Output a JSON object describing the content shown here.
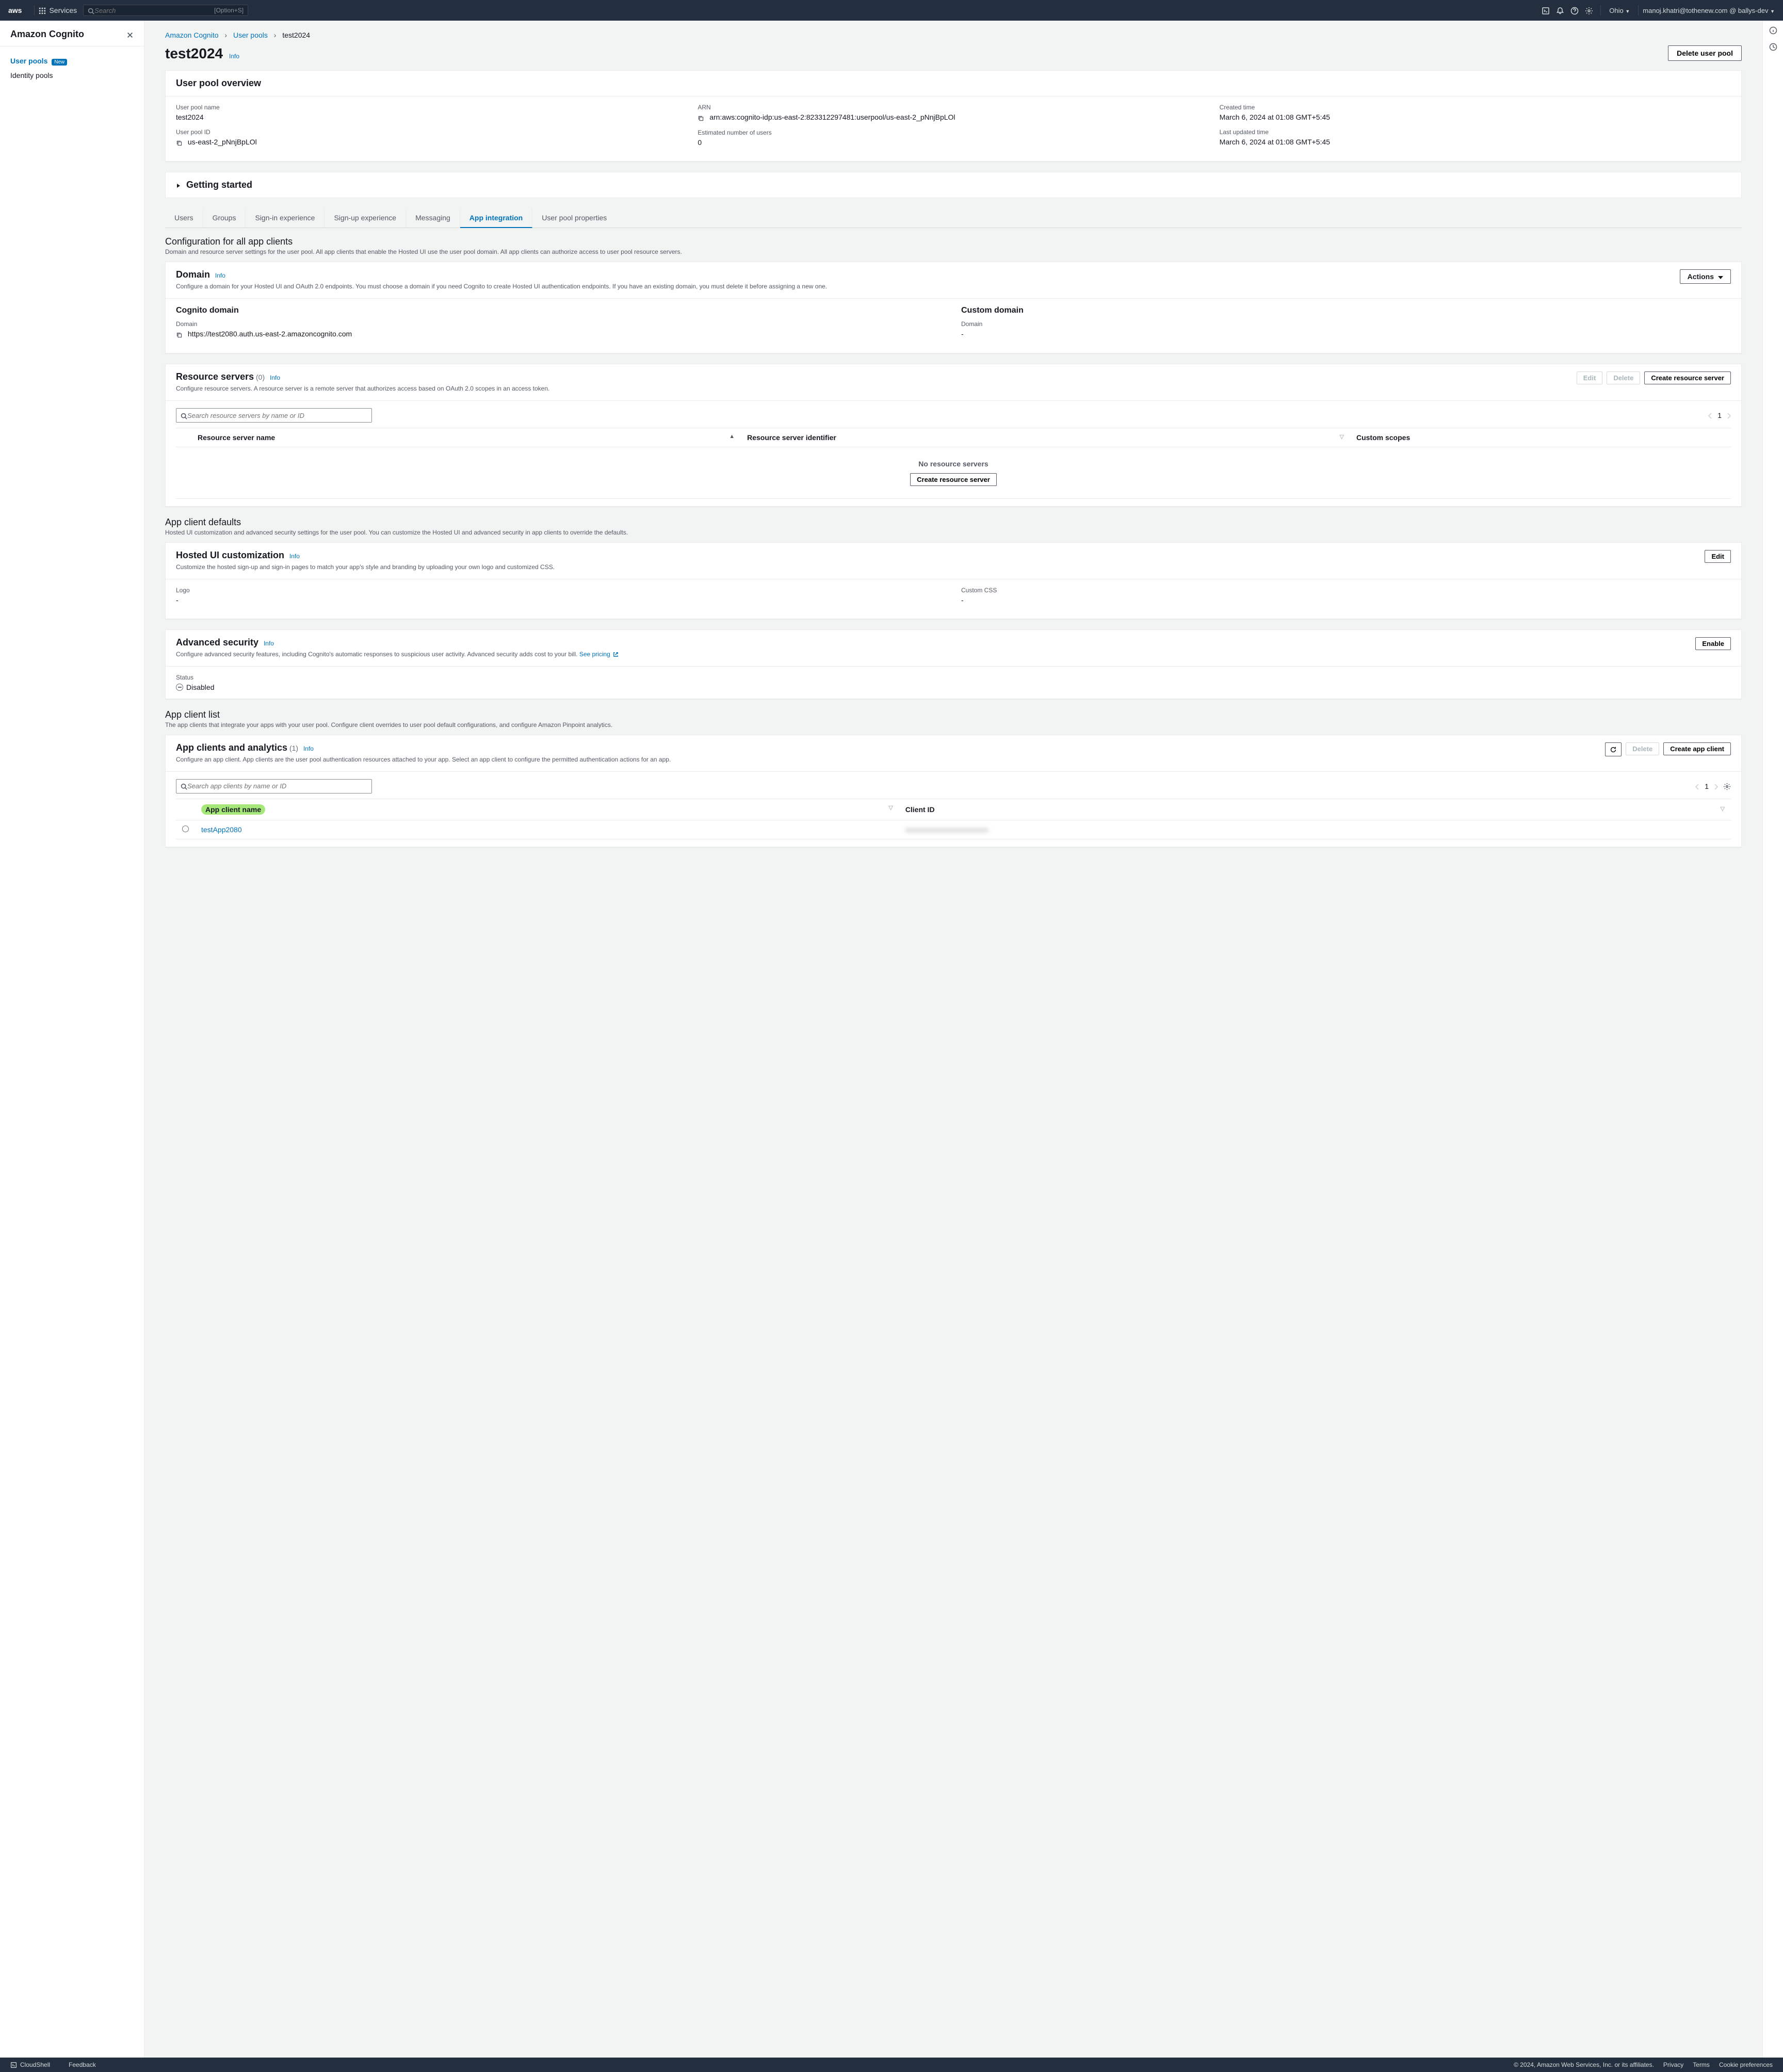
{
  "topnav": {
    "logo": "aws",
    "services": "Services",
    "search_placeholder": "Search",
    "shortcut": "[Option+S]",
    "region": "Ohio",
    "user": "manoj.khatri@tothenew.com @ ballys-dev"
  },
  "sidebar": {
    "title": "Amazon Cognito",
    "items": [
      {
        "label": "User pools",
        "badge": "New",
        "active": true
      },
      {
        "label": "Identity pools",
        "active": false
      }
    ]
  },
  "breadcrumb": {
    "items": [
      "Amazon Cognito",
      "User pools",
      "test2024"
    ]
  },
  "page": {
    "title": "test2024",
    "info": "Info",
    "delete_btn": "Delete user pool"
  },
  "overview": {
    "title": "User pool overview",
    "name_label": "User pool name",
    "name_value": "test2024",
    "id_label": "User pool ID",
    "id_value": "us-east-2_pNnjBpLOl",
    "arn_label": "ARN",
    "arn_value": "arn:aws:cognito-idp:us-east-2:823312297481:userpool/us-east-2_pNnjBpLOl",
    "users_label": "Estimated number of users",
    "users_value": "0",
    "created_label": "Created time",
    "created_value": "March 6, 2024 at 01:08 GMT+5:45",
    "updated_label": "Last updated time",
    "updated_value": "March 6, 2024 at 01:08 GMT+5:45"
  },
  "getting_started": "Getting started",
  "tabs": [
    "Users",
    "Groups",
    "Sign-in experience",
    "Sign-up experience",
    "Messaging",
    "App integration",
    "User pool properties"
  ],
  "active_tab": "App integration",
  "config_section": {
    "title": "Configuration for all app clients",
    "desc": "Domain and resource server settings for the user pool. All app clients that enable the Hosted UI use the user pool domain. All app clients can authorize access to user pool resource servers."
  },
  "domain_panel": {
    "title": "Domain",
    "info": "Info",
    "desc": "Configure a domain for your Hosted UI and OAuth 2.0 endpoints. You must choose a domain if you need Cognito to create Hosted UI authentication endpoints. If you have an existing domain, you must delete it before assigning a new one.",
    "actions_btn": "Actions",
    "cognito_domain_h": "Cognito domain",
    "domain_label": "Domain",
    "domain_value": "https://test2080.auth.us-east-2.amazoncognito.com",
    "custom_domain_h": "Custom domain",
    "custom_domain_label": "Domain",
    "custom_domain_value": "-"
  },
  "resource_servers": {
    "title": "Resource servers",
    "count": "(0)",
    "info": "Info",
    "desc": "Configure resource servers. A resource server is a remote server that authorizes access based on OAuth 2.0 scopes in an access token.",
    "edit_btn": "Edit",
    "delete_btn": "Delete",
    "create_btn": "Create resource server",
    "search_placeholder": "Search resource servers by name or ID",
    "page_num": "1",
    "col1": "Resource server name",
    "col2": "Resource server identifier",
    "col3": "Custom scopes",
    "empty_msg": "No resource servers",
    "empty_btn": "Create resource server"
  },
  "app_defaults": {
    "title": "App client defaults",
    "desc": "Hosted UI customization and advanced security settings for the user pool. You can customize the Hosted UI and advanced security in app clients to override the defaults."
  },
  "hosted_ui": {
    "title": "Hosted UI customization",
    "info": "Info",
    "desc": "Customize the hosted sign-up and sign-in pages to match your app's style and branding by uploading your own logo and customized CSS.",
    "edit_btn": "Edit",
    "logo_label": "Logo",
    "logo_value": "-",
    "css_label": "Custom CSS",
    "css_value": "-"
  },
  "advanced_security": {
    "title": "Advanced security",
    "info": "Info",
    "desc_prefix": "Configure advanced security features, including Cognito's automatic responses to suspicious user activity. Advanced security adds cost to your bill. ",
    "pricing_link": "See pricing",
    "enable_btn": "Enable",
    "status_label": "Status",
    "status_value": "Disabled"
  },
  "app_client_list": {
    "title": "App client list",
    "desc": "The app clients that integrate your apps with your user pool. Configure client overrides to user pool default configurations, and configure Amazon Pinpoint analytics."
  },
  "app_clients": {
    "title": "App clients and analytics",
    "count": "(1)",
    "info": "Info",
    "desc": "Configure an app client. App clients are the user pool authentication resources attached to your app. Select an app client to configure the permitted authentication actions for an app.",
    "refresh": "refresh",
    "delete_btn": "Delete",
    "create_btn": "Create app client",
    "search_placeholder": "Search app clients by name or ID",
    "page_num": "1",
    "col1": "App client name",
    "col2": "Client ID",
    "row1_name": "testApp2080"
  },
  "footer": {
    "cloudshell": "CloudShell",
    "feedback": "Feedback",
    "copyright": "© 2024, Amazon Web Services, Inc. or its affiliates.",
    "privacy": "Privacy",
    "terms": "Terms",
    "cookies": "Cookie preferences"
  }
}
